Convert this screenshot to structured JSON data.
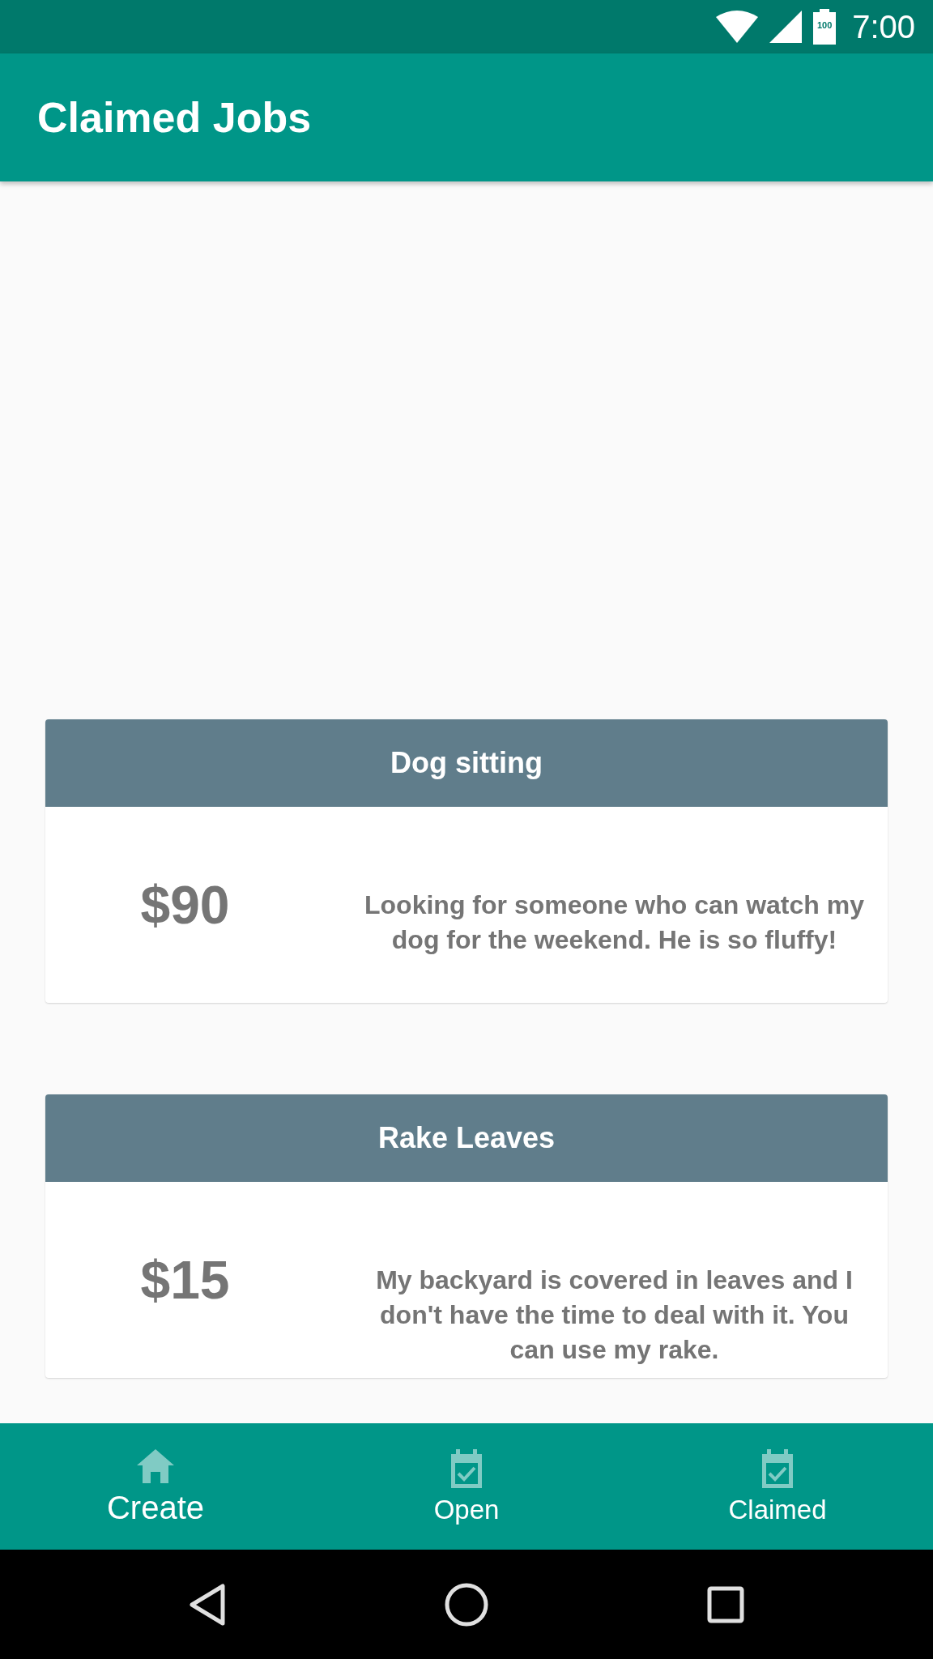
{
  "status_bar": {
    "time": "7:00",
    "battery": "100"
  },
  "app_bar": {
    "title": "Claimed Jobs"
  },
  "jobs": [
    {
      "title": "Dog sitting",
      "price": "$90",
      "description": "Looking for someone who can watch my dog for the weekend. He is so fluffy!"
    },
    {
      "title": "Rake Leaves",
      "price": "$15",
      "description": "My backyard is covered in leaves and I don't have the time to deal with it. You can use my rake."
    }
  ],
  "bottom_nav": [
    {
      "label": "Create",
      "kind": "home",
      "selected": true
    },
    {
      "label": "Open",
      "kind": "calendar",
      "selected": false
    },
    {
      "label": "Claimed",
      "kind": "calendar",
      "selected": false
    }
  ]
}
